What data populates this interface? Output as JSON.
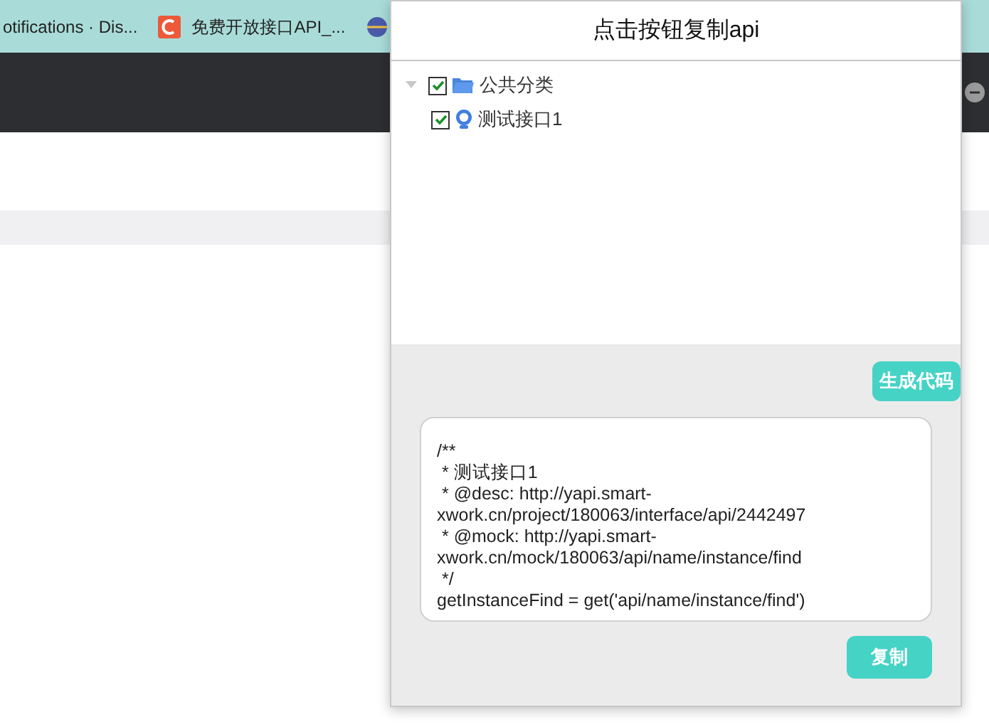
{
  "bookmarks": [
    {
      "kind": "plain",
      "label": "otifications · Dis..."
    },
    {
      "kind": "c-logo",
      "label": "免费开放接口API_..."
    },
    {
      "kind": "globe"
    }
  ],
  "dialog": {
    "title": "点击按钮复制api",
    "tree": [
      {
        "kind": "folder",
        "label": "公共分类",
        "checked": true,
        "expanded": true,
        "children": [
          {
            "kind": "api",
            "label": "测试接口1",
            "checked": true
          }
        ]
      }
    ],
    "generate_button": "生成代码",
    "code": "/**\n * 测试接口1\n * @desc: http://yapi.smart-xwork.cn/project/180063/interface/api/2442497\n * @mock: http://yapi.smart-xwork.cn/mock/180063/api/name/instance/find\n */\ngetInstanceFind = get('api/name/instance/find')",
    "copy_button": "复制"
  }
}
